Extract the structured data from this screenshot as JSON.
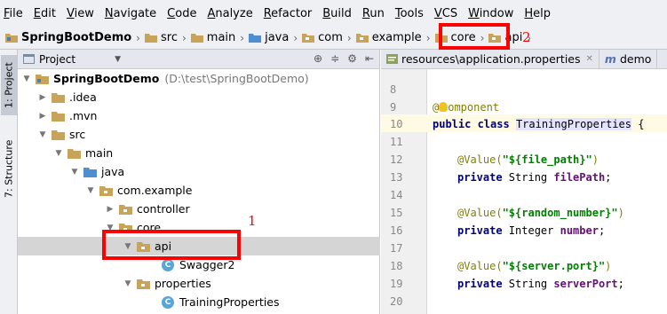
{
  "menu": [
    "File",
    "Edit",
    "View",
    "Navigate",
    "Code",
    "Analyze",
    "Refactor",
    "Build",
    "Run",
    "Tools",
    "VCS",
    "Window",
    "Help"
  ],
  "breadcrumb": [
    "SpringBootDemo",
    "src",
    "main",
    "java",
    "com",
    "example",
    "core",
    "api"
  ],
  "toolwindows": {
    "project": "1: Project",
    "structure": "7: Structure"
  },
  "project_panel": {
    "title": "Project",
    "tree": [
      {
        "label": "SpringBootDemo",
        "path": "(D:\\test\\SpringBootDemo)"
      },
      {
        "label": ".idea"
      },
      {
        "label": ".mvn"
      },
      {
        "label": "src"
      },
      {
        "label": "main"
      },
      {
        "label": "java"
      },
      {
        "label": "com.example"
      },
      {
        "label": "controller"
      },
      {
        "label": "core"
      },
      {
        "label": "api"
      },
      {
        "label": "Swagger2"
      },
      {
        "label": "properties"
      },
      {
        "label": "TrainingProperties"
      }
    ]
  },
  "editor": {
    "tabs": [
      "resources\\application.properties",
      "demo"
    ],
    "line_numbers": [
      "8",
      "9",
      "10",
      "11",
      "12",
      "13",
      "14",
      "15",
      "16",
      "17",
      "18",
      "19",
      "20"
    ],
    "component_rest": "omponent",
    "class_line": {
      "kw": "public class",
      "name": "TrainingProperties",
      "rest": " {"
    },
    "fields": [
      {
        "ann": "@Value(",
        "arg": "\"${file_path}\"",
        "close": ")",
        "decl_kw": "private",
        "type": " String ",
        "name": "filePath",
        "end": ";"
      },
      {
        "ann": "@Value(",
        "arg": "\"${random_number}\"",
        "close": ")",
        "decl_kw": "private",
        "type": " Integer ",
        "name": "number",
        "end": ";"
      },
      {
        "ann": "@Value(",
        "arg": "\"${server.port}\"",
        "close": ")",
        "decl_kw": "private",
        "type": " String ",
        "name": "serverPort",
        "end": ";"
      }
    ]
  },
  "annotations": {
    "marker1": "1",
    "marker2": "2"
  },
  "colors": {
    "highlight_box": "#ff0000",
    "selection": "#d5d5d5",
    "folder": "#c8a45a"
  }
}
